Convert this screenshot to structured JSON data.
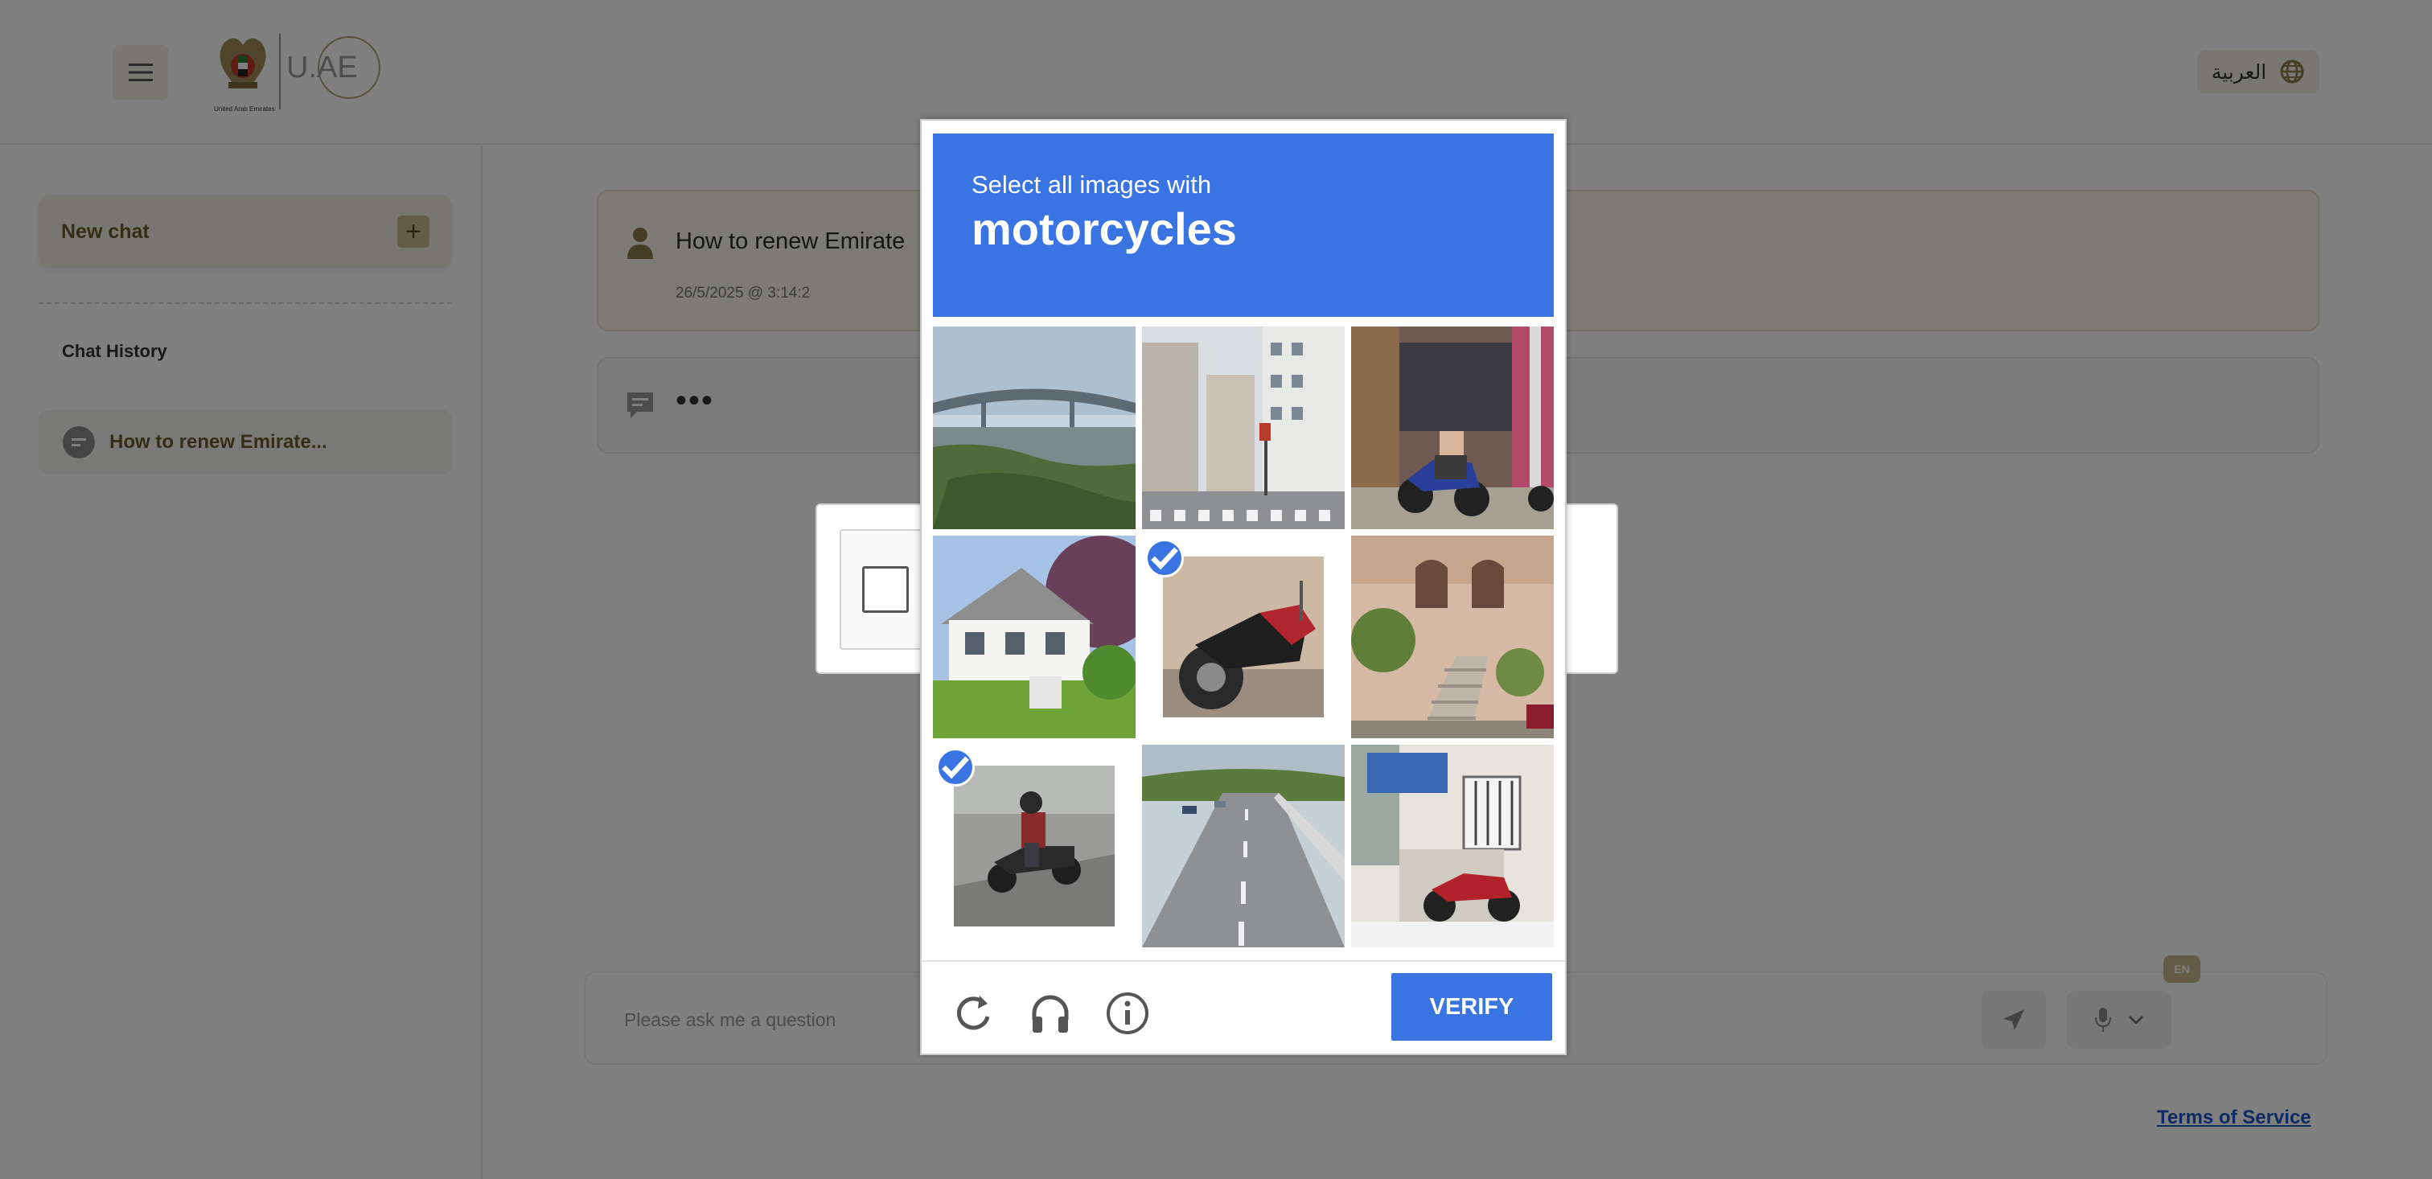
{
  "header": {
    "lang_label": "العربية",
    "logo_caption": "United Arab Emirates",
    "logo_text": "U.AE"
  },
  "sidebar": {
    "new_chat_label": "New chat",
    "history_title": "Chat History",
    "history_items": [
      {
        "label": "How to renew Emirate..."
      }
    ]
  },
  "chat": {
    "user_message": "How to renew Emirate",
    "user_timestamp": "26/5/2025 @ 3:14:2",
    "bot_message": "•••"
  },
  "input": {
    "placeholder": "Please ask me a question",
    "lang_badge": "EN"
  },
  "footer": {
    "terms_label": "Terms of Service"
  },
  "captcha": {
    "instruction": "Select all images with",
    "target": "motorcycles",
    "verify_label": "VERIFY",
    "tiles": [
      {
        "scene": "river-bridge",
        "selected": false
      },
      {
        "scene": "city-street",
        "selected": false
      },
      {
        "scene": "shop-with-motorcycles",
        "selected": false
      },
      {
        "scene": "white-house",
        "selected": false
      },
      {
        "scene": "motorcycle-closeup",
        "selected": true
      },
      {
        "scene": "house-with-stairs",
        "selected": false
      },
      {
        "scene": "motorcycle-rider",
        "selected": true
      },
      {
        "scene": "highway",
        "selected": false
      },
      {
        "scene": "motorcycle-by-building",
        "selected": false
      }
    ]
  },
  "colors": {
    "captcha_blue": "#3a73e2",
    "brand_gold": "#c9b98f",
    "link_blue": "#1a56c4"
  }
}
